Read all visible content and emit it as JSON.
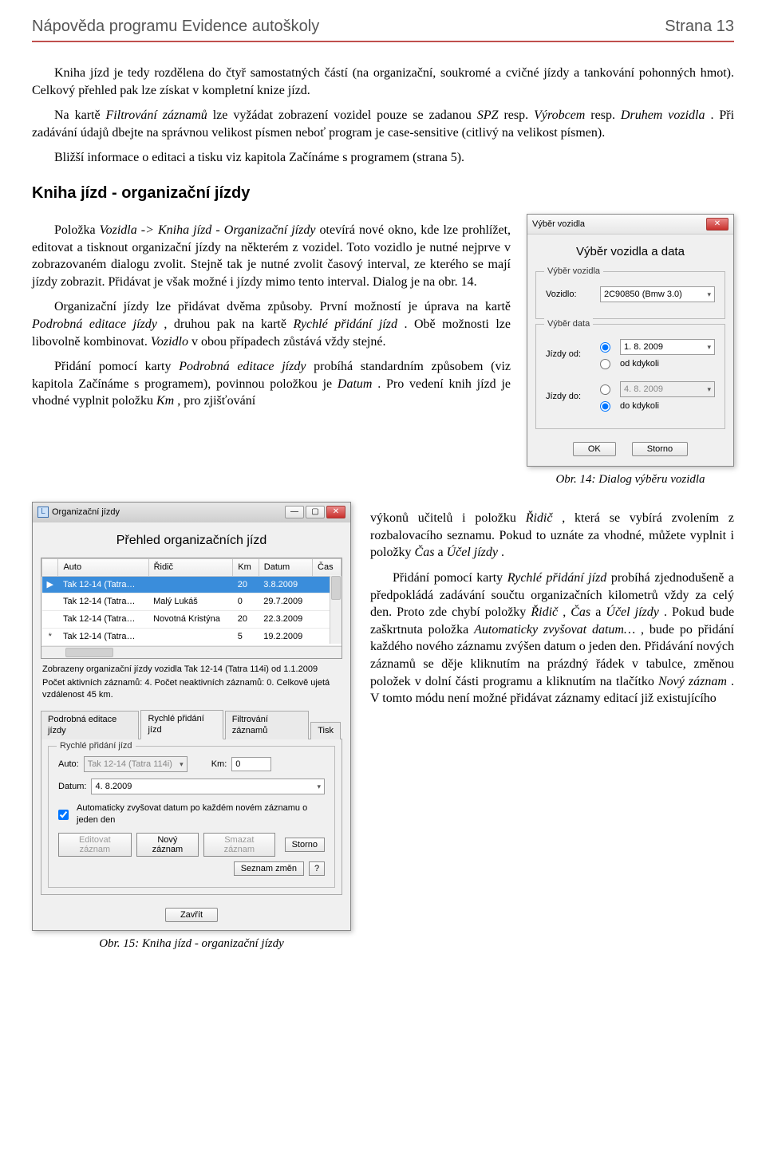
{
  "header": {
    "left": "Nápověda programu Evidence autoškoly",
    "right": "Strana 13"
  },
  "para1": "Kniha jízd je tedy rozdělena do čtyř samostatných částí (na organizační, soukromé a cvičné jízdy a tankování pohonných hmot). Celkový přehled pak lze získat v kompletní knize jízd.",
  "para2_a": "Na kartě ",
  "para2_i1": "Filtrování záznamů",
  "para2_b": " lze vyžádat zobrazení vozidel pouze se zadanou ",
  "para2_i2": "SPZ",
  "para2_c": " resp. ",
  "para2_i3": "Výrobcem",
  "para2_d": " resp. ",
  "para2_i4": "Druhem vozidla",
  "para2_e": ". Při zadávání údajů dbejte na správnou velikost písmen neboť program je case-sensitive (citlivý na velikost písmen).",
  "para3": "Bližší informace o editaci a tisku viz kapitola Začínáme s programem (strana 5).",
  "section_title": "Kniha jízd - organizační jízdy",
  "paraA_a": "Položka ",
  "paraA_i1": "Vozidla -> Kniha jízd - Organizační jízdy",
  "paraA_b": " otevírá nové okno, kde lze prohlížet, editovat a tisknout organizační jízdy na některém z vozidel. Toto vozidlo je nutné nejprve v zobrazovaném dialogu zvolit. Stejně tak je nutné zvolit časový interval, ze kterého se mají jízdy zobrazit. Přidávat je však možné i jízdy mimo tento interval. Dialog je na obr. 14.",
  "paraB_a": "Organizační jízdy lze přidávat dvěma způsoby. První možností je úprava na kartě ",
  "paraB_i1": "Podrobná editace jízdy",
  "paraB_b": ", druhou pak na kartě ",
  "paraB_i2": "Rychlé přidání jízd",
  "paraB_c": ". Obě možnosti lze libovolně kombinovat. ",
  "paraB_i3": "Vozidlo",
  "paraB_d": " v obou případech zůstává vždy stejné.",
  "paraC_a": "Přidání pomocí karty ",
  "paraC_i1": "Podrobná editace jízdy",
  "paraC_b": " probíhá standardním způsobem (viz kapitola Začínáme s programem), povinnou položkou je ",
  "paraC_i2": "Datum",
  "paraC_c": ". Pro vedení knih jízd je vhodné vyplnit položku ",
  "paraC_i3": "Km",
  "paraC_d": ", pro zjišťování",
  "paraD_a": "výkonů učitelů i položku ",
  "paraD_i1": "Řidič",
  "paraD_b": ", která se vybírá zvolením z rozbalovacího seznamu. Pokud to uznáte za vhodné, můžete vyplnit i položky ",
  "paraD_i2": "Čas",
  "paraD_c": " a ",
  "paraD_i3": "Účel jízdy",
  "paraD_d": ".",
  "paraE_a": "Přidání pomocí karty ",
  "paraE_i1": "Rychlé přidání jízd",
  "paraE_b": " probíhá zjednodušeně a předpokládá zadávání součtu organizačních kilometrů vždy za celý den. Proto zde chybí položky ",
  "paraE_i2": "Řidič",
  "paraE_c": ", ",
  "paraE_i3": "Čas",
  "paraE_d": " a ",
  "paraE_i4": "Účel jízdy",
  "paraE_e": ". Pokud bude zaškrtnuta položka ",
  "paraE_i5": "Automaticky zvyšovat datum…",
  "paraE_f": ", bude po přidání každého nového záznamu zvýšen datum o jeden den. Přidávání nových záznamů se děje kliknutím na prázdný řádek v tabulce, změnou položek v dolní části programu a kliknutím na tlačítko ",
  "paraE_i6": "Nový záznam",
  "paraE_g": ". V tomto módu není možné přidávat záznamy editací již existujícího",
  "dlg1": {
    "title": "Výběr vozidla",
    "heading": "Výběr vozidla a data",
    "group_vehicle": "Výběr vozidla",
    "lbl_vehicle": "Vozidlo:",
    "val_vehicle": "2C90850 (Bmw 3.0)",
    "group_date": "Výběr data",
    "lbl_from": "Jízdy od:",
    "opt_from_date": "1. 8. 2009",
    "opt_from_any": "od kdykoli",
    "lbl_to": "Jízdy do:",
    "opt_to_date": "4. 8. 2009",
    "opt_to_any": "do kdykoli",
    "btn_ok": "OK",
    "btn_cancel": "Storno",
    "caption": "Obr. 14: Dialog výběru vozidla"
  },
  "win2": {
    "title": "Organizační jízdy",
    "heading": "Přehled organizačních jízd",
    "cols": [
      "Auto",
      "Řidič",
      "Km",
      "Datum",
      "Čas"
    ],
    "rows": [
      {
        "auto": "Tak 12-14 (Tatra…",
        "ridic": "",
        "km": "20",
        "datum": "3.8.2009",
        "cas": "",
        "sel": true
      },
      {
        "auto": "Tak 12-14 (Tatra…",
        "ridic": "Malý Lukáš",
        "km": "0",
        "datum": "29.7.2009",
        "cas": ""
      },
      {
        "auto": "Tak 12-14 (Tatra…",
        "ridic": "Novotná Kristýna",
        "km": "20",
        "datum": "22.3.2009",
        "cas": ""
      },
      {
        "auto": "Tak 12-14 (Tatra…",
        "ridic": "",
        "km": "5",
        "datum": "19.2.2009",
        "cas": ""
      }
    ],
    "status1": "Zobrazeny organizační jízdy vozidla Tak 12-14 (Tatra 114i) od 1.1.2009",
    "status2": "Počet aktivních záznamů: 4. Počet neaktivních záznamů: 0. Celkově ujetá vzdálenost 45 km.",
    "tabs": [
      "Podrobná editace jízdy",
      "Rychlé přidání jízd",
      "Filtrování záznamů",
      "Tisk"
    ],
    "grouplabel": "Rychlé přidání jízd",
    "lbl_auto": "Auto:",
    "val_auto": "Tak 12-14 (Tatra 114i)",
    "lbl_km": "Km:",
    "val_km": "0",
    "lbl_datum": "Datum:",
    "val_datum": "4. 8.2009",
    "chk_label": "Automaticky zvyšovat datum po každém novém záznamu o jeden den",
    "btn_edit": "Editovat záznam",
    "btn_new": "Nový záznam",
    "btn_del": "Smazat záznam",
    "btn_storno": "Storno",
    "btn_changes": "Seznam změn",
    "btn_q": "?",
    "btn_close": "Zavřít",
    "caption": "Obr. 15: Kniha jízd - organizační jízdy"
  }
}
